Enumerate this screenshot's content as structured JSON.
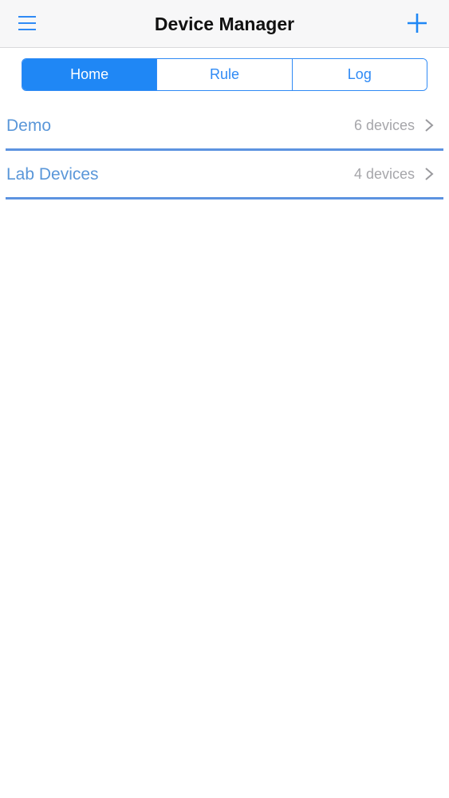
{
  "header": {
    "title": "Device Manager",
    "menu_icon": "hamburger-menu-icon",
    "add_icon": "plus-icon"
  },
  "tabs": [
    {
      "label": "Home",
      "selected": true
    },
    {
      "label": "Rule",
      "selected": false
    },
    {
      "label": "Log",
      "selected": false
    }
  ],
  "groups": [
    {
      "name": "Demo",
      "count": "6 devices"
    },
    {
      "name": "Lab Devices",
      "count": "4 devices"
    }
  ],
  "colors": {
    "accent": "#1f87f5",
    "row_title": "#5a97d9",
    "separator": "#5c93e0",
    "count_text": "#a6a6aa"
  }
}
